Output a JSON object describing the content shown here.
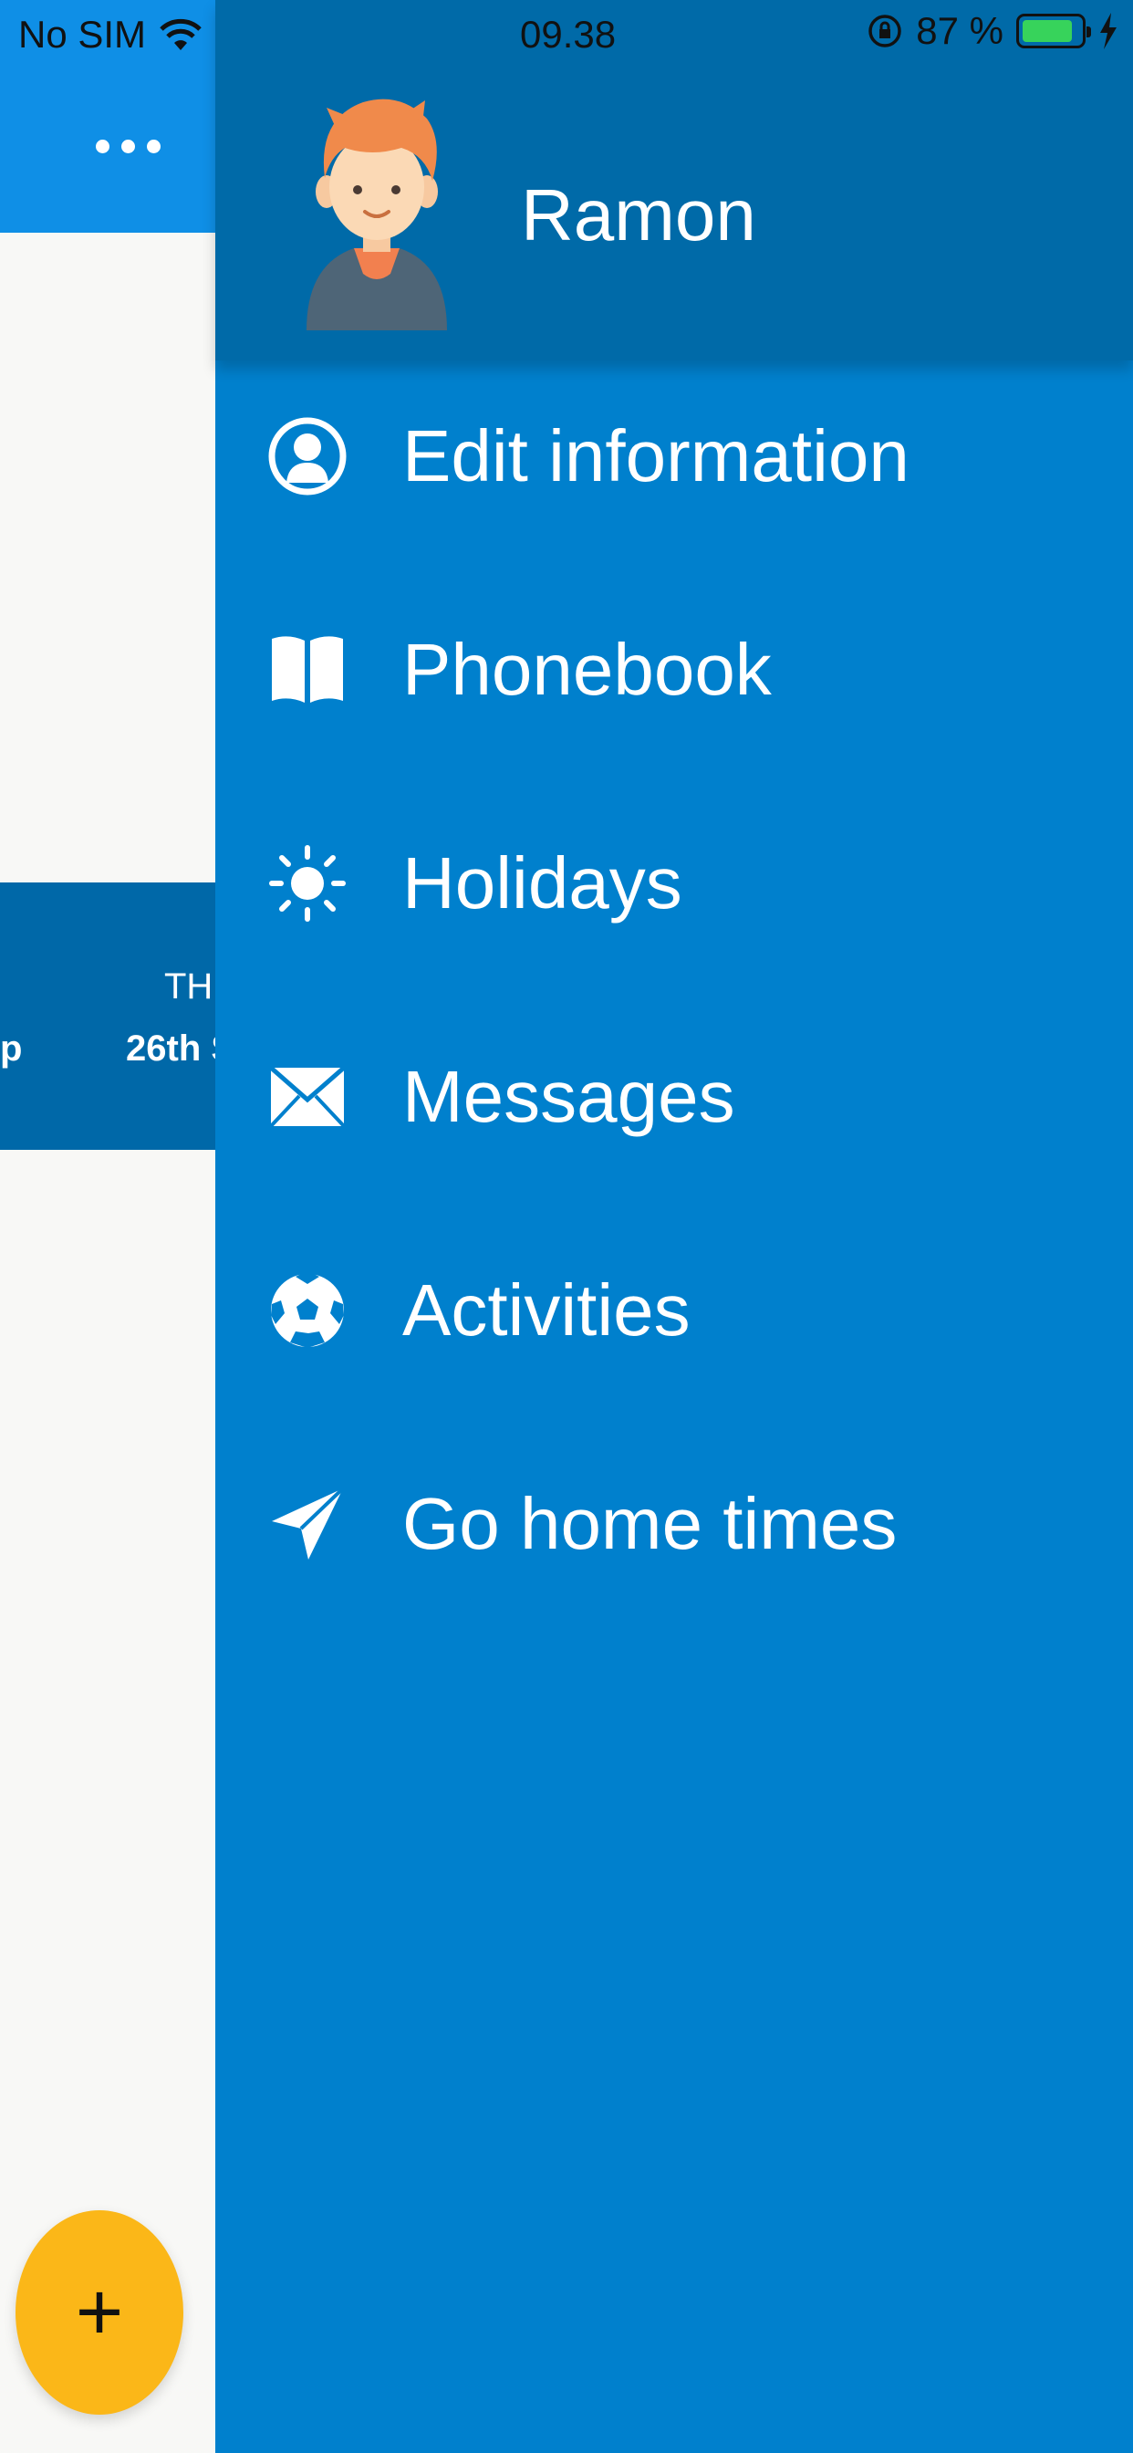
{
  "status_bar": {
    "carrier": "No SIM",
    "time": "09.38",
    "battery": "87 %",
    "battery_level": 0.87
  },
  "background": {
    "day": "TH",
    "date": "26th S",
    "partial": "p",
    "fab_label": "+"
  },
  "drawer": {
    "user_name": "Ramon",
    "items": [
      {
        "label": "Edit information",
        "icon": "user-icon"
      },
      {
        "label": "Phonebook",
        "icon": "book-icon"
      },
      {
        "label": "Holidays",
        "icon": "sun-icon"
      },
      {
        "label": "Messages",
        "icon": "envelope-icon"
      },
      {
        "label": "Activities",
        "icon": "soccer-ball-icon"
      },
      {
        "label": "Go home times",
        "icon": "paper-plane-icon"
      }
    ]
  },
  "colors": {
    "drawer_bg": "#0080cd",
    "drawer_header": "#006aa8",
    "app_bar": "#0f8fe6",
    "fab": "#fbb718"
  }
}
